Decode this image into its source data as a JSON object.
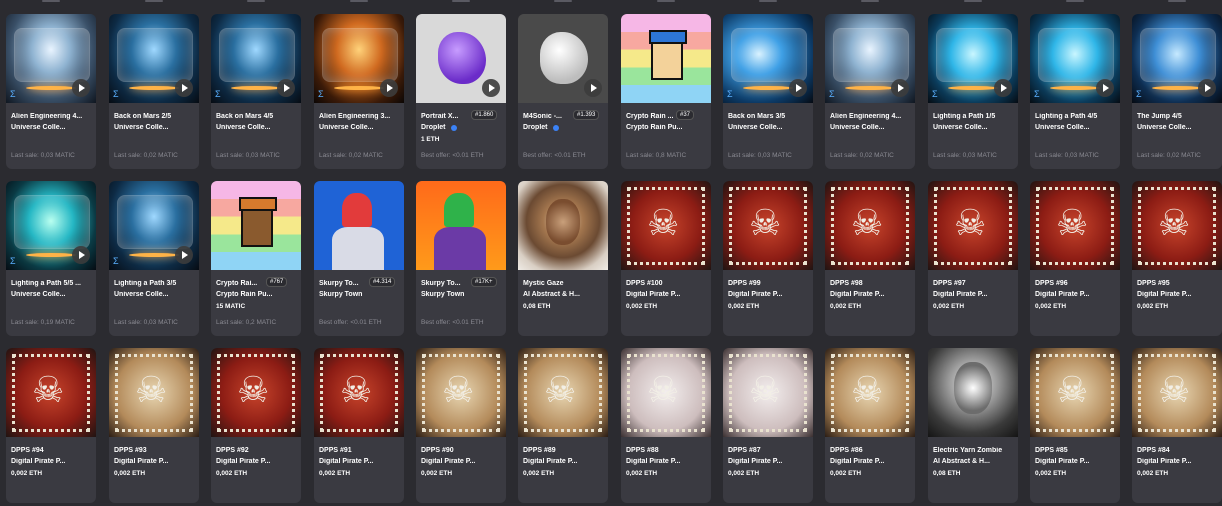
{
  "cards": [
    {
      "row": 0,
      "col": 0,
      "art": "alien",
      "line1": "Alien Engineering 4...",
      "line2": "Universe Colle...",
      "price": "",
      "footer": "Last sale: 0,03 MATIC",
      "rank": "",
      "brand": "sigma-icon"
    },
    {
      "row": 0,
      "col": 1,
      "art": "mars",
      "line1": "Back on Mars 2/5",
      "line2": "Universe Colle...",
      "price": "",
      "footer": "Last sale: 0,02 MATIC",
      "rank": "",
      "brand": "sigma-icon"
    },
    {
      "row": 0,
      "col": 2,
      "art": "mars",
      "line1": "Back on Mars 4/5",
      "line2": "Universe Colle...",
      "price": "",
      "footer": "Last sale: 0,03 MATIC",
      "rank": "",
      "brand": "sigma-icon"
    },
    {
      "row": 0,
      "col": 3,
      "art": "orange",
      "line1": "Alien Engineering 3...",
      "line2": "Universe Colle...",
      "price": "",
      "footer": "Last sale: 0,02 MATIC",
      "rank": "",
      "brand": "sigma-icon"
    },
    {
      "row": 0,
      "col": 4,
      "art": "droplet-purple",
      "line1": "Portrait X...",
      "line2": "Droplet",
      "price": "1 ETH",
      "footer": "Best offer: <0.01 ETH",
      "rank": "#1.860",
      "brand": ""
    },
    {
      "row": 0,
      "col": 5,
      "art": "droplet-white",
      "line1": "M4Sonic -...",
      "line2": "Droplet",
      "price": "",
      "footer": "Best offer: <0.01 ETH",
      "rank": "#1.393",
      "brand": ""
    },
    {
      "row": 0,
      "col": 6,
      "art": "punk-white",
      "line1": "Crypto Rain ...",
      "line2": "Crypto Rain Pu...",
      "price": "",
      "footer": "Last sale: 0,8 MATIC",
      "rank": "#37",
      "brand": ""
    },
    {
      "row": 0,
      "col": 7,
      "art": "mars-blue",
      "line1": "Back on Mars 3/5",
      "line2": "Universe Colle...",
      "price": "",
      "footer": "Last sale: 0,03 MATIC",
      "rank": "",
      "brand": "sigma-icon"
    },
    {
      "row": 0,
      "col": 8,
      "art": "alien",
      "line1": "Alien Engineering 4...",
      "line2": "Universe Colle...",
      "price": "",
      "footer": "Last sale: 0,02 MATIC",
      "rank": "",
      "brand": "sigma-icon"
    },
    {
      "row": 0,
      "col": 9,
      "art": "cyan",
      "line1": "Lighting a Path 1/5",
      "line2": "Universe Colle...",
      "price": "",
      "footer": "Last sale: 0,03 MATIC",
      "rank": "",
      "brand": "sigma-icon"
    },
    {
      "row": 0,
      "col": 10,
      "art": "cyan",
      "line1": "Lighting a Path 4/5",
      "line2": "Universe Colle...",
      "price": "",
      "footer": "Last sale: 0,03 MATIC",
      "rank": "",
      "brand": "sigma-icon"
    },
    {
      "row": 0,
      "col": 11,
      "art": "jump",
      "line1": "The Jump 4/5",
      "line2": "Universe Colle...",
      "price": "",
      "footer": "Last sale: 0,02 MATIC",
      "rank": "",
      "brand": "sigma-icon"
    },
    {
      "row": 1,
      "col": 0,
      "art": "cyan-green",
      "line1": "Lighting a Path 5/5 ...",
      "line2": "Universe Colle...",
      "price": "",
      "footer": "Last sale: 0,19 MATIC",
      "rank": "",
      "brand": "sigma-icon"
    },
    {
      "row": 1,
      "col": 1,
      "art": "mars",
      "line1": "Lighting a Path 3/5",
      "line2": "Universe Colle...",
      "price": "",
      "footer": "Last sale: 0,03 MATIC",
      "rank": "",
      "brand": "sigma-icon"
    },
    {
      "row": 1,
      "col": 2,
      "art": "punk-orange",
      "line1": "Crypto Rai...",
      "line2": "Crypto Rain Pu...",
      "price": "15 MATIC",
      "footer": "Last sale: 0,2 MATIC",
      "rank": "#767",
      "brand": ""
    },
    {
      "row": 1,
      "col": 3,
      "art": "skurpy-red",
      "line1": "Skurpy To...",
      "line2": "Skurpy Town",
      "price": "",
      "footer": "Best offer: <0.01 ETH",
      "rank": "#4.314",
      "brand": ""
    },
    {
      "row": 1,
      "col": 4,
      "art": "skurpy-green",
      "line1": "Skurpy To...",
      "line2": "Skurpy Town",
      "price": "",
      "footer": "Best offer: <0.01 ETH",
      "rank": "#17K+",
      "brand": ""
    },
    {
      "row": 1,
      "col": 5,
      "art": "mystic",
      "line1": "Mystic Gaze",
      "line2": "AI Abstract & H...",
      "price": "0,08 ETH",
      "footer": "",
      "rank": "",
      "brand": ""
    },
    {
      "row": 1,
      "col": 6,
      "art": "stamp-red",
      "line1": "DPPS #100",
      "line2": "Digital Pirate P...",
      "price": "0,002 ETH",
      "footer": "",
      "rank": "",
      "brand": ""
    },
    {
      "row": 1,
      "col": 7,
      "art": "stamp-red",
      "line1": "DPPS #99",
      "line2": "Digital Pirate P...",
      "price": "0,002 ETH",
      "footer": "",
      "rank": "",
      "brand": ""
    },
    {
      "row": 1,
      "col": 8,
      "art": "stamp-red",
      "line1": "DPPS #98",
      "line2": "Digital Pirate P...",
      "price": "0,002 ETH",
      "footer": "",
      "rank": "",
      "brand": ""
    },
    {
      "row": 1,
      "col": 9,
      "art": "stamp-red",
      "line1": "DPPS #97",
      "line2": "Digital Pirate P...",
      "price": "0,002 ETH",
      "footer": "",
      "rank": "",
      "brand": ""
    },
    {
      "row": 1,
      "col": 10,
      "art": "stamp-red",
      "line1": "DPPS #96",
      "line2": "Digital Pirate P...",
      "price": "0,002 ETH",
      "footer": "",
      "rank": "",
      "brand": ""
    },
    {
      "row": 1,
      "col": 11,
      "art": "stamp-red",
      "line1": "DPPS #95",
      "line2": "Digital Pirate P...",
      "price": "0,002 ETH",
      "footer": "",
      "rank": "",
      "brand": ""
    },
    {
      "row": 2,
      "col": 0,
      "art": "stamp-red",
      "line1": "DPPS #94",
      "line2": "Digital Pirate P...",
      "price": "0,002 ETH",
      "footer": "",
      "rank": "",
      "brand": ""
    },
    {
      "row": 2,
      "col": 1,
      "art": "stamp-tan",
      "line1": "DPPS #93",
      "line2": "Digital Pirate P...",
      "price": "0,002 ETH",
      "footer": "",
      "rank": "",
      "brand": ""
    },
    {
      "row": 2,
      "col": 2,
      "art": "stamp-red",
      "line1": "DPPS #92",
      "line2": "Digital Pirate P...",
      "price": "0,002 ETH",
      "footer": "",
      "rank": "",
      "brand": ""
    },
    {
      "row": 2,
      "col": 3,
      "art": "stamp-red",
      "line1": "DPPS #91",
      "line2": "Digital Pirate P...",
      "price": "0,002 ETH",
      "footer": "",
      "rank": "",
      "brand": ""
    },
    {
      "row": 2,
      "col": 4,
      "art": "stamp-tan",
      "line1": "DPPS #90",
      "line2": "Digital Pirate P...",
      "price": "0,002 ETH",
      "footer": "",
      "rank": "",
      "brand": ""
    },
    {
      "row": 2,
      "col": 5,
      "art": "stamp-tan",
      "line1": "DPPS #89",
      "line2": "Digital Pirate P...",
      "price": "0,002 ETH",
      "footer": "",
      "rank": "",
      "brand": ""
    },
    {
      "row": 2,
      "col": 6,
      "art": "stamp-grey",
      "line1": "DPPS #88",
      "line2": "Digital Pirate P...",
      "price": "0,002 ETH",
      "footer": "",
      "rank": "",
      "brand": ""
    },
    {
      "row": 2,
      "col": 7,
      "art": "stamp-grey",
      "line1": "DPPS #87",
      "line2": "Digital Pirate P...",
      "price": "0,002 ETH",
      "footer": "",
      "rank": "",
      "brand": ""
    },
    {
      "row": 2,
      "col": 8,
      "art": "stamp-tan",
      "line1": "DPPS #86",
      "line2": "Digital Pirate P...",
      "price": "0,002 ETH",
      "footer": "",
      "rank": "",
      "brand": ""
    },
    {
      "row": 2,
      "col": 9,
      "art": "zombie",
      "line1": "Electric Yarn Zombie",
      "line2": "AI Abstract & H...",
      "price": "0,08 ETH",
      "footer": "",
      "rank": "",
      "brand": ""
    },
    {
      "row": 2,
      "col": 10,
      "art": "stamp-tan",
      "line1": "DPPS #85",
      "line2": "Digital Pirate P...",
      "price": "0,002 ETH",
      "footer": "",
      "rank": "",
      "brand": ""
    },
    {
      "row": 2,
      "col": 11,
      "art": "stamp-tan",
      "line1": "DPPS #84",
      "line2": "Digital Pirate P...",
      "price": "0,002 ETH",
      "footer": "",
      "rank": "",
      "brand": ""
    }
  ],
  "colors": {
    "background": "#2b2b30",
    "card": "#3a3a41",
    "muted": "#8a8a92",
    "verified": "#3b82f6"
  },
  "icons": {
    "play": "play-icon",
    "brand": "sigma-icon",
    "verified": "verified-badge-icon"
  }
}
